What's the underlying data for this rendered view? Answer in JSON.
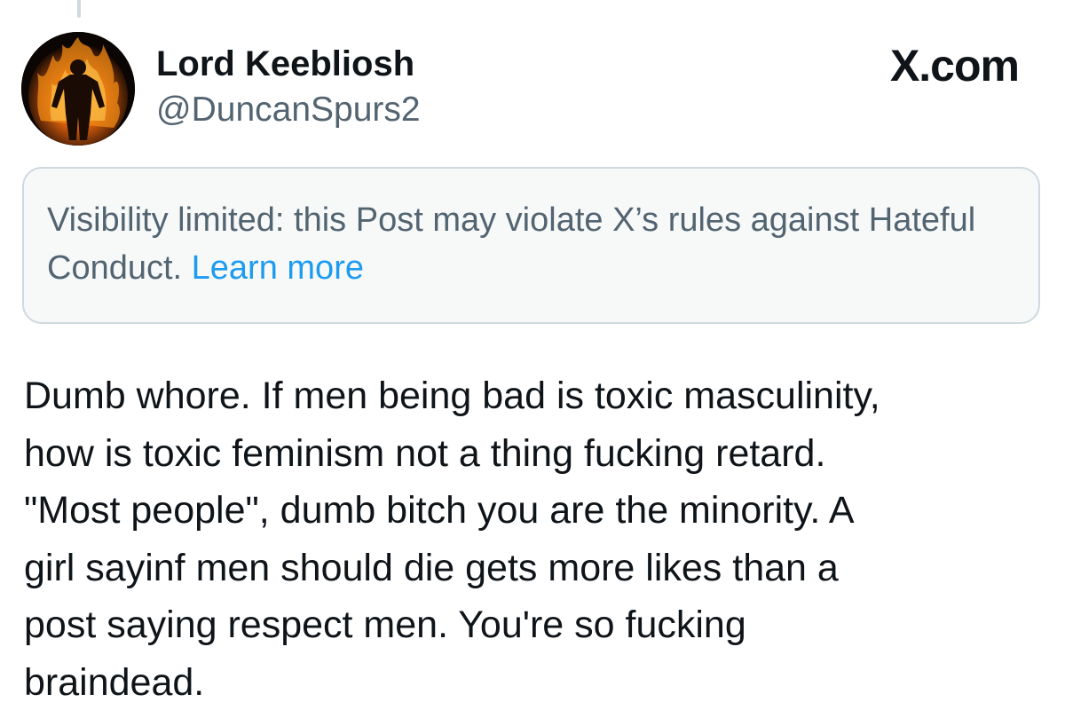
{
  "author": {
    "display_name": "Lord Keebliosh",
    "handle": "@DuncanSpurs2",
    "avatar_icon": "flaming-figure-avatar-icon"
  },
  "brand": {
    "label": "X.com"
  },
  "notice": {
    "text": "Visibility limited: this Post may violate X’s rules against Hateful Conduct.",
    "link_label": "Learn more"
  },
  "post": {
    "lines": [
      "Dumb whore. If men being bad is toxic masculinity,",
      "how is toxic feminism not a thing fucking retard.",
      "\"Most people\", dumb bitch you are the minority. A",
      "girl sayinf men should die gets more likes than a",
      "post saying respect men. You're so fucking",
      "braindead."
    ]
  },
  "colors": {
    "primary_text": "#0f1419",
    "secondary_text": "#536471",
    "link": "#1d9bf0",
    "notice_background": "#f7f9f9",
    "notice_border": "#cfd9de"
  }
}
